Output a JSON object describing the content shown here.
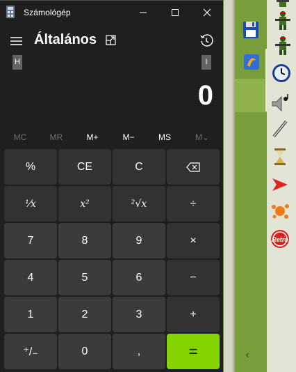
{
  "window": {
    "title": "Számológép",
    "mode_title": "Általános",
    "key_tip_left": "H",
    "key_tip_right": "I"
  },
  "display": {
    "value": "0"
  },
  "memory": [
    {
      "label": "MC",
      "enabled": false
    },
    {
      "label": "MR",
      "enabled": false
    },
    {
      "label": "M+",
      "enabled": true
    },
    {
      "label": "M−",
      "enabled": true
    },
    {
      "label": "MS",
      "enabled": true
    },
    {
      "label": "M⌄",
      "enabled": false
    }
  ],
  "keys": {
    "percent": "%",
    "clear_entry": "CE",
    "clear": "C",
    "backspace": "⌫",
    "reciprocal": "⅟x",
    "square": "x²",
    "sqrt": "²√x",
    "divide": "÷",
    "seven": "7",
    "eight": "8",
    "nine": "9",
    "multiply": "×",
    "four": "4",
    "five": "5",
    "six": "6",
    "subtract": "−",
    "one": "1",
    "two": "2",
    "three": "3",
    "add": "+",
    "negate": "⁺/₋",
    "zero": "0",
    "decimal": ",",
    "equals": "="
  },
  "colors": {
    "window_background": "#1f1f1f",
    "operator_key": "#323232",
    "number_key": "#3b3b3b",
    "equals_accent": "#84d400",
    "desktop_panel": "#789d3a"
  },
  "tray_icons": [
    "soldier-icon",
    "floppy-disk-icon",
    "soldier-icon",
    "soldier-icon",
    "blue-app-icon",
    "clock-icon",
    "speaker-icon",
    "pen-icon",
    "hourglass-icon",
    "red-arrow-icon",
    "orange-splash-icon",
    "retro-logo-icon"
  ]
}
